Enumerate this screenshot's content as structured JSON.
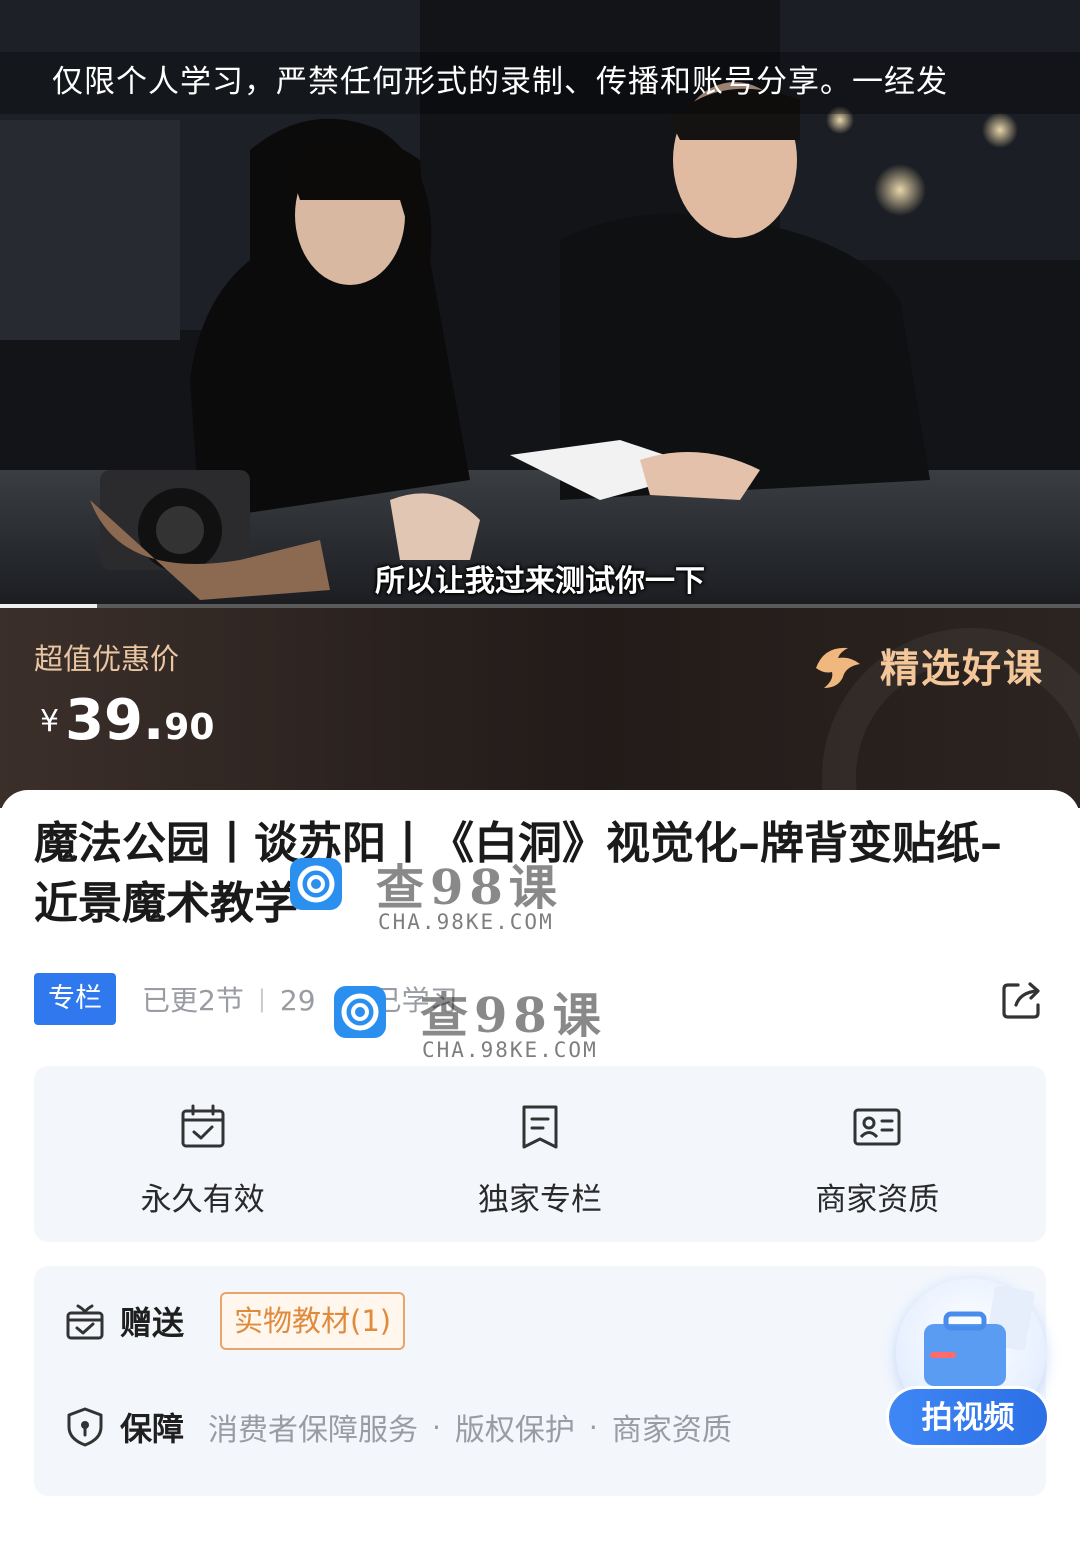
{
  "video": {
    "notice": "仅限个人学习，严禁任何形式的录制、传播和账号分享。一经发",
    "subtitle": "所以让我过来测试你一下",
    "progress": 0.09
  },
  "price_banner": {
    "label": "超值优惠价",
    "currency": "¥",
    "price_int": "39.",
    "price_dec": "90",
    "badge": "精选好课"
  },
  "course": {
    "title": "魔法公园丨谈苏阳丨《白洞》视觉化–牌背变贴纸–近景魔术教学",
    "tag": "专栏",
    "updates": "已更2节",
    "learners": "29",
    "learners_suffix": "已学习"
  },
  "watermark": {
    "cn": "查98课",
    "en": "CHA.98KE.COM"
  },
  "features": [
    {
      "label": "永久有效",
      "icon": "calendar-check-icon"
    },
    {
      "label": "独家专栏",
      "icon": "bookmark-icon"
    },
    {
      "label": "商家资质",
      "icon": "id-card-icon"
    }
  ],
  "gift": {
    "label": "赠送",
    "item": "实物教材(1)"
  },
  "guarantee": {
    "label": "保障",
    "items": [
      "消费者保障服务",
      "版权保护",
      "商家资质"
    ]
  },
  "fab": {
    "label": "拍视频"
  },
  "colors": {
    "accent_blue": "#2f78ee",
    "gold": "#e9c6a2",
    "gift_orange": "#e08a3c"
  }
}
